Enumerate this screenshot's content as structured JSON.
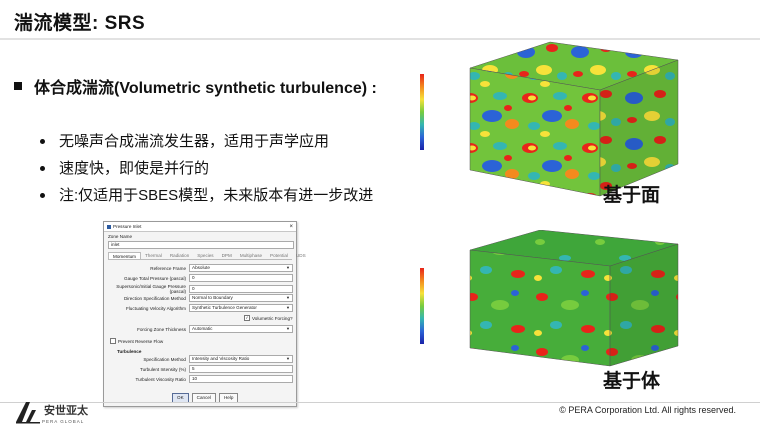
{
  "slide": {
    "title": "湍流模型: SRS",
    "main_bullet": "体合成湍流(Volumetric synthetic turbulence) :",
    "sub_bullets": [
      "无噪声合成湍流发生器，适用于声学应用",
      "速度快，即使是并行的",
      "注:仅适用于SBES模型，未来版本有进一步改进"
    ]
  },
  "dialog": {
    "title": "Pressure Inlet",
    "zone_label": "Zone Name",
    "zone_value": "inlet",
    "tabs": [
      "Momentum",
      "Thermal",
      "Radiation",
      "Species",
      "DPM",
      "Multiphase",
      "Potential",
      "UDS"
    ],
    "active_tab": "Momentum",
    "fields": {
      "reference_frame": {
        "label": "Reference Frame",
        "value": "Absolute"
      },
      "gauge_total_pressure": {
        "label": "Gauge Total Pressure (pascal)",
        "value": "0"
      },
      "supersonic_pressure": {
        "label": "Supersonic/Initial Gauge Pressure (pascal)",
        "value": "0"
      },
      "direction_method": {
        "label": "Direction Specification Method",
        "value": "Normal to Boundary"
      },
      "fluctuating_velocity": {
        "label": "Fluctuating Velocity Algorithm",
        "value": "Synthetic Turbulence Generator"
      },
      "volumetric_forcing": {
        "label": "Volumetric Forcing?",
        "checked": true
      },
      "forcing_zone_thickness": {
        "label": "Forcing Zone Thickness",
        "value": "Automatic"
      },
      "prevent_reverse_flow": {
        "label": "Prevent Reverse Flow",
        "checked": false
      },
      "turbulence_group": "Turbulence",
      "specification_method": {
        "label": "Specification Method",
        "value": "Intensity and Viscosity Ratio"
      },
      "turbulent_intensity": {
        "label": "Turbulent Intensity (%)",
        "value": "5"
      },
      "turbulent_viscosity_ratio": {
        "label": "Turbulent Viscosity Ratio",
        "value": "10"
      }
    },
    "buttons": {
      "ok": "OK",
      "cancel": "Cancel",
      "help": "Help"
    }
  },
  "figures": {
    "top_caption": "基于面",
    "bottom_caption": "基于体"
  },
  "footer": {
    "copyright": "© PERA Corporation Ltd. All rights reserved.",
    "logo_text": "安世亚太",
    "logo_sub": "PERA GLOBAL"
  },
  "colors": {
    "contour_high": "#e8241a",
    "contour_mid": "#77cc3e",
    "contour_low": "#1a22a8"
  }
}
